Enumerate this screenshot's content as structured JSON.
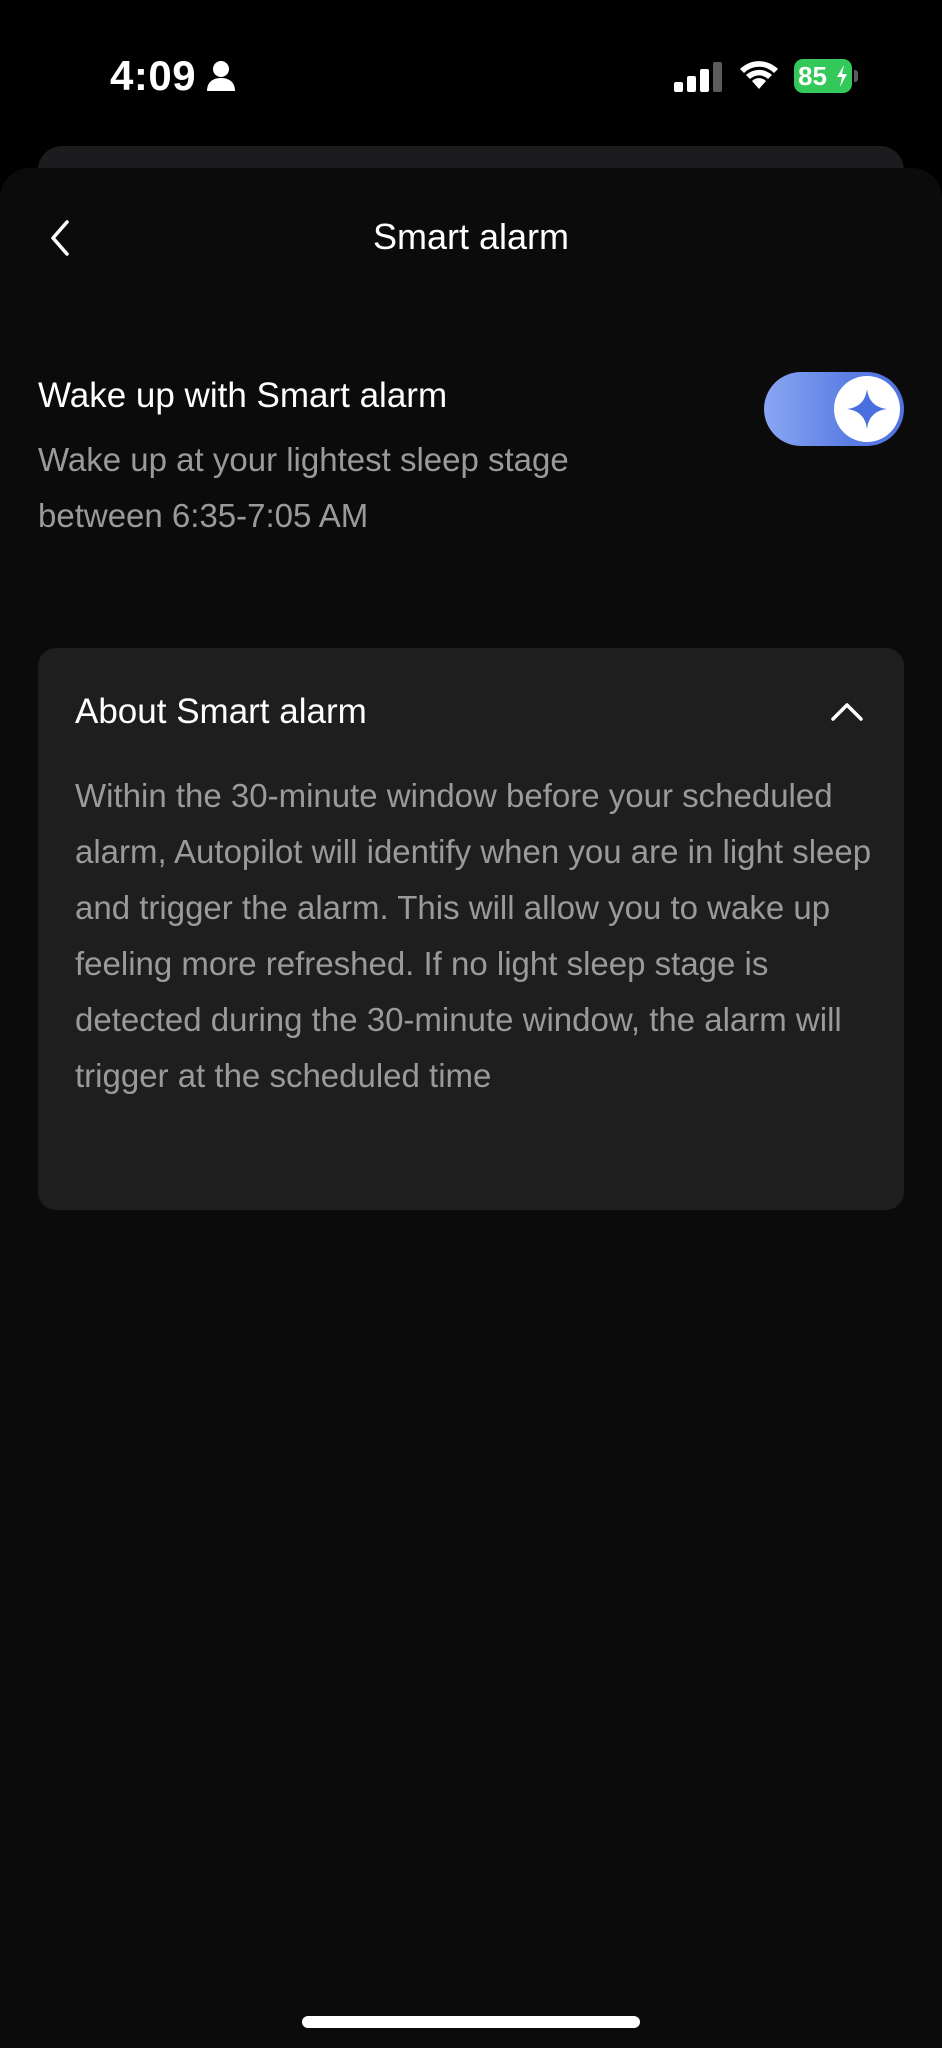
{
  "status_bar": {
    "time": "4:09",
    "battery_level": "85",
    "icons": [
      "person-icon",
      "signal-icon",
      "wifi-icon",
      "battery-charging-icon"
    ],
    "battery_color": "#34c759"
  },
  "nav": {
    "title": "Smart alarm",
    "back_icon": "chevron-left-icon"
  },
  "smart_alarm": {
    "title": "Wake up with Smart alarm",
    "description": "Wake up at your lightest sleep stage between 6:35-7:05 AM",
    "toggle_on": true,
    "toggle_icon": "sparkle-icon",
    "toggle_color": "#5c7ee4"
  },
  "about": {
    "title": "About Smart alarm",
    "expanded": true,
    "chevron_icon": "chevron-up-icon",
    "body": "Within the 30-minute window before your scheduled alarm, Autopilot will identify when you are in light sleep and trigger the alarm. This will allow you to wake up feeling more refreshed. If no light sleep stage is detected during the 30-minute window, the alarm will trigger at the scheduled time"
  }
}
